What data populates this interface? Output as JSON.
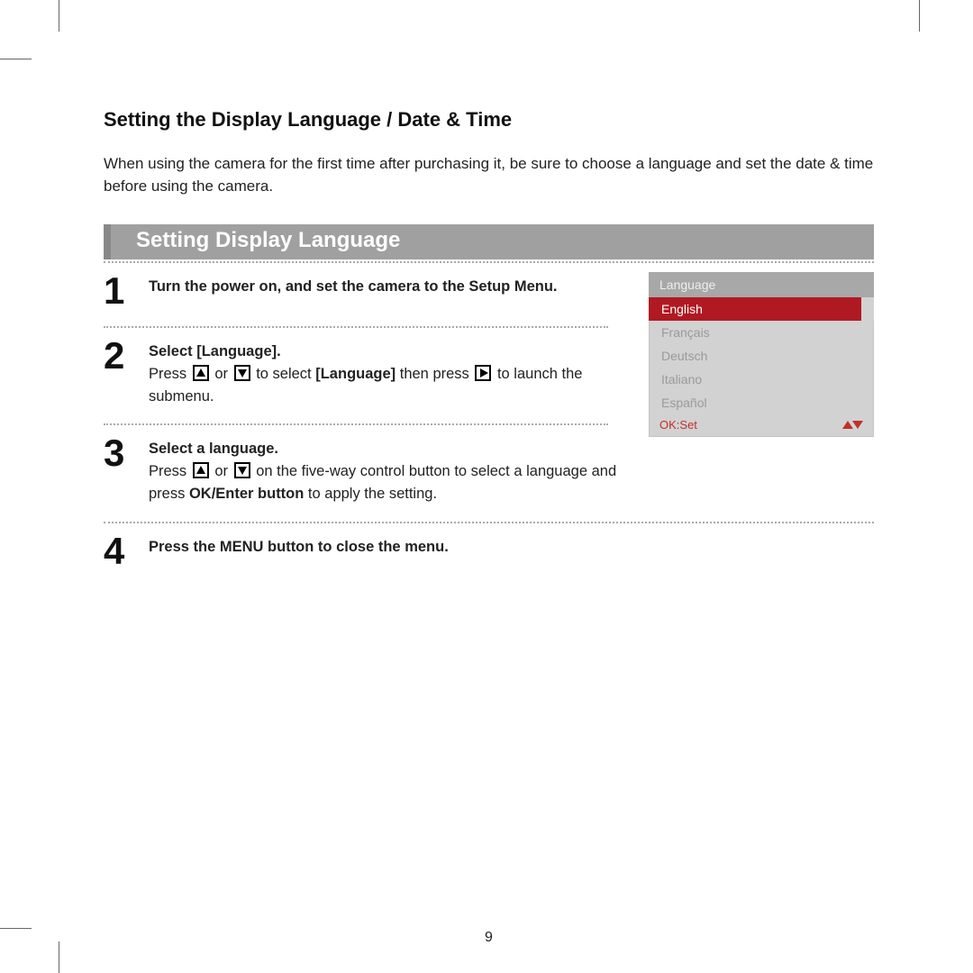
{
  "page": {
    "title": "Setting the Display Language / Date & Time",
    "intro": "When using the camera for the first time after purchasing it, be sure to choose a language and set the date & time before using the camera.",
    "banner": "Setting Display Language",
    "number": "9"
  },
  "steps": {
    "s1": {
      "num": "1",
      "title": "Turn the power on, and set the camera to the Setup Menu."
    },
    "s2": {
      "num": "2",
      "title": "Select [Language].",
      "press": "Press ",
      "or": " or ",
      "mid": "  to select ",
      "kw": "[Language]",
      "then": " then press ",
      "tail": " to launch the submenu."
    },
    "s3": {
      "num": "3",
      "title": "Select a language.",
      "press": "Press ",
      "or": " or ",
      "mid": " on the five-way control button to select a language and press ",
      "kw": "OK/Enter button",
      "tail": " to apply the setting."
    },
    "s4": {
      "num": "4",
      "title": "Press the MENU button to close the menu."
    }
  },
  "menu": {
    "header": "Language",
    "items": [
      "English",
      "Français",
      "Deutsch",
      "Italiano",
      "Español"
    ],
    "selected_index": 0,
    "footer_ok": "OK:Set"
  }
}
